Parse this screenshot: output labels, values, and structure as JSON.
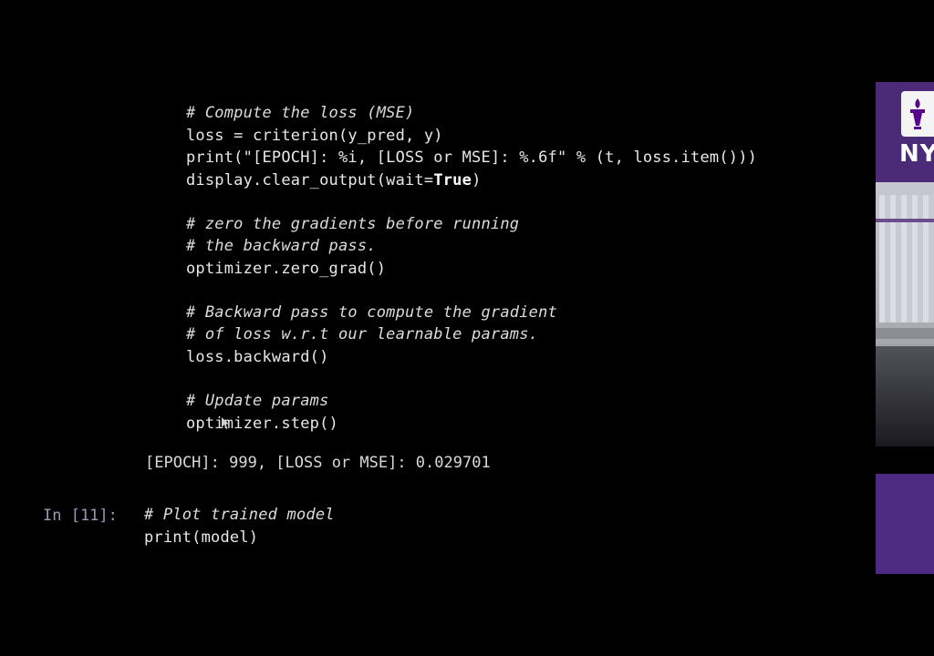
{
  "code_cell": {
    "lines": [
      {
        "text": "# Compute the loss (MSE)",
        "type": "comment"
      },
      {
        "text": "loss = criterion(y_pred, y)",
        "type": "code"
      },
      {
        "text": "print(\"[EPOCH]: %i, [LOSS or MSE]: %.6f\" % (t, loss.item()))",
        "type": "code"
      },
      {
        "text": "display.clear_output(wait=",
        "type": "code",
        "suffix_bold": "True",
        "suffix": ")"
      },
      {
        "text": "",
        "type": "blank"
      },
      {
        "text": "# zero the gradients before running",
        "type": "comment"
      },
      {
        "text": "# the backward pass.",
        "type": "comment"
      },
      {
        "text": "optimizer.zero_grad()",
        "type": "code"
      },
      {
        "text": "",
        "type": "blank"
      },
      {
        "text": "# Backward pass to compute the gradient",
        "type": "comment"
      },
      {
        "text": "# of loss w.r.t our learnable params.",
        "type": "comment"
      },
      {
        "text": "loss.backward()",
        "type": "code"
      },
      {
        "text": "",
        "type": "blank"
      },
      {
        "text": "# Update params",
        "type": "comment"
      },
      {
        "text": "optimizer.step()",
        "type": "code"
      }
    ]
  },
  "output": {
    "text": "[EPOCH]: 999, [LOSS or MSE]: 0.029701"
  },
  "next_cell": {
    "prompt": "In [11]:",
    "line1": "# Plot trained model",
    "line2": "print(model)"
  },
  "side_video": {
    "logo_text": "NY",
    "brand_color": "#57068c"
  },
  "colors": {
    "background": "#000000",
    "code_text": "#e8e8e8",
    "prompt": "#9a9ab8"
  }
}
